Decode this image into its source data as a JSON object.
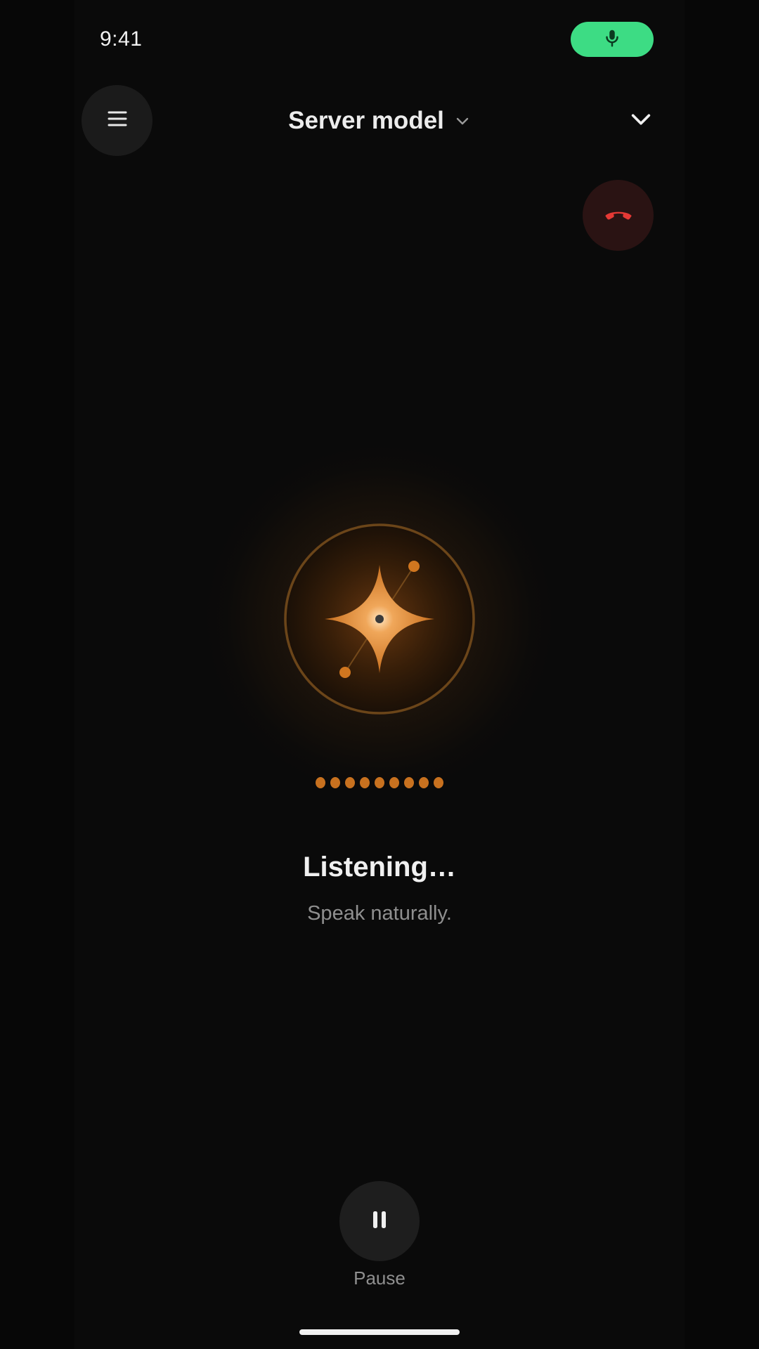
{
  "status_bar": {
    "time": "9:41",
    "mic_indicator_icon": "microphone-icon",
    "mic_indicator_color": "#3ddc84"
  },
  "header": {
    "menu_icon": "hamburger-menu-icon",
    "model_title": "Server model",
    "model_caret_icon": "chevron-down-icon",
    "collapse_icon": "chevron-down-icon"
  },
  "call": {
    "end_call_icon": "hang-up-phone-icon",
    "end_call_color": "#e53935"
  },
  "voice": {
    "orb_icon": "sparkle-orb-icon",
    "accent_color": "#c8711f",
    "status_title": "Listening…",
    "status_subtitle": "Speak naturally."
  },
  "controls": {
    "pause_icon": "pause-icon",
    "pause_label": "Pause"
  }
}
